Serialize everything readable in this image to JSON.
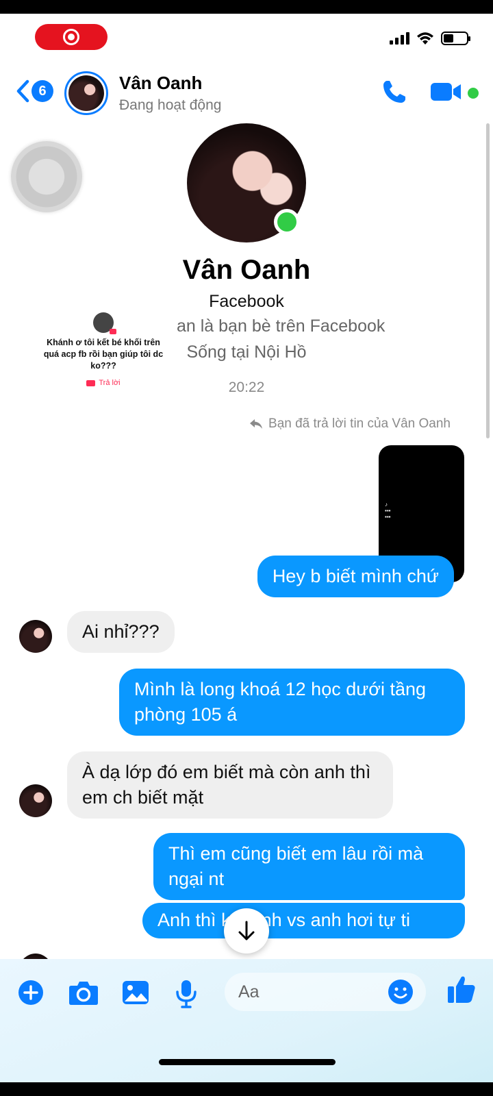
{
  "colors": {
    "accent": "#0a7cff",
    "outgoing_bubble": "#0a98ff",
    "incoming_bubble": "#efefef",
    "online": "#31cc46",
    "recording": "#e5131f"
  },
  "status_bar": {
    "recording_icon": "record-icon",
    "signal_icon": "signal-icon",
    "wifi_icon": "wifi-icon",
    "battery_icon": "battery-icon",
    "battery_level": 0.4
  },
  "header": {
    "back_count": "6",
    "name": "Vân Oanh",
    "status": "Đang hoạt động",
    "call_icon": "phone-icon",
    "video_icon": "video-call-icon"
  },
  "profile": {
    "name": "Vân Oanh",
    "network": "Facebook",
    "friends": "an là bạn bè trên Facebook",
    "lives": "Sống tại Nội Hồ"
  },
  "timestamp": "20:22",
  "tiktok_overlay": {
    "text": "Khánh ơ tôi kết bé khối trên quá acp fb rồi bạn giúp tôi dc ko???",
    "reply_label": "Trả lời"
  },
  "reply_note": "Bạn đã trả lời tin của Vân Oanh",
  "messages": [
    {
      "from": "me",
      "text": "Hey b biết mình chứ"
    },
    {
      "from": "them",
      "text": "Ai nhỉ???"
    },
    {
      "from": "me",
      "text": "Mình là long khoá 12 học dưới tầng phòng 105 á"
    },
    {
      "from": "them",
      "text": "À  dạ lớp đó em biết mà còn anh thì em ch biết mặt"
    },
    {
      "from": "me",
      "text": "Thì em cũng biết em lâu rồi mà ngại nt"
    },
    {
      "from": "me",
      "text": "Anh thì k ó ảnh vs anh hơi tự ti"
    }
  ],
  "composer": {
    "placeholder": "Aa",
    "icons": [
      "plus-icon",
      "camera-icon",
      "image-icon",
      "microphone-icon",
      "emoji-icon",
      "thumbs-up-icon"
    ]
  }
}
